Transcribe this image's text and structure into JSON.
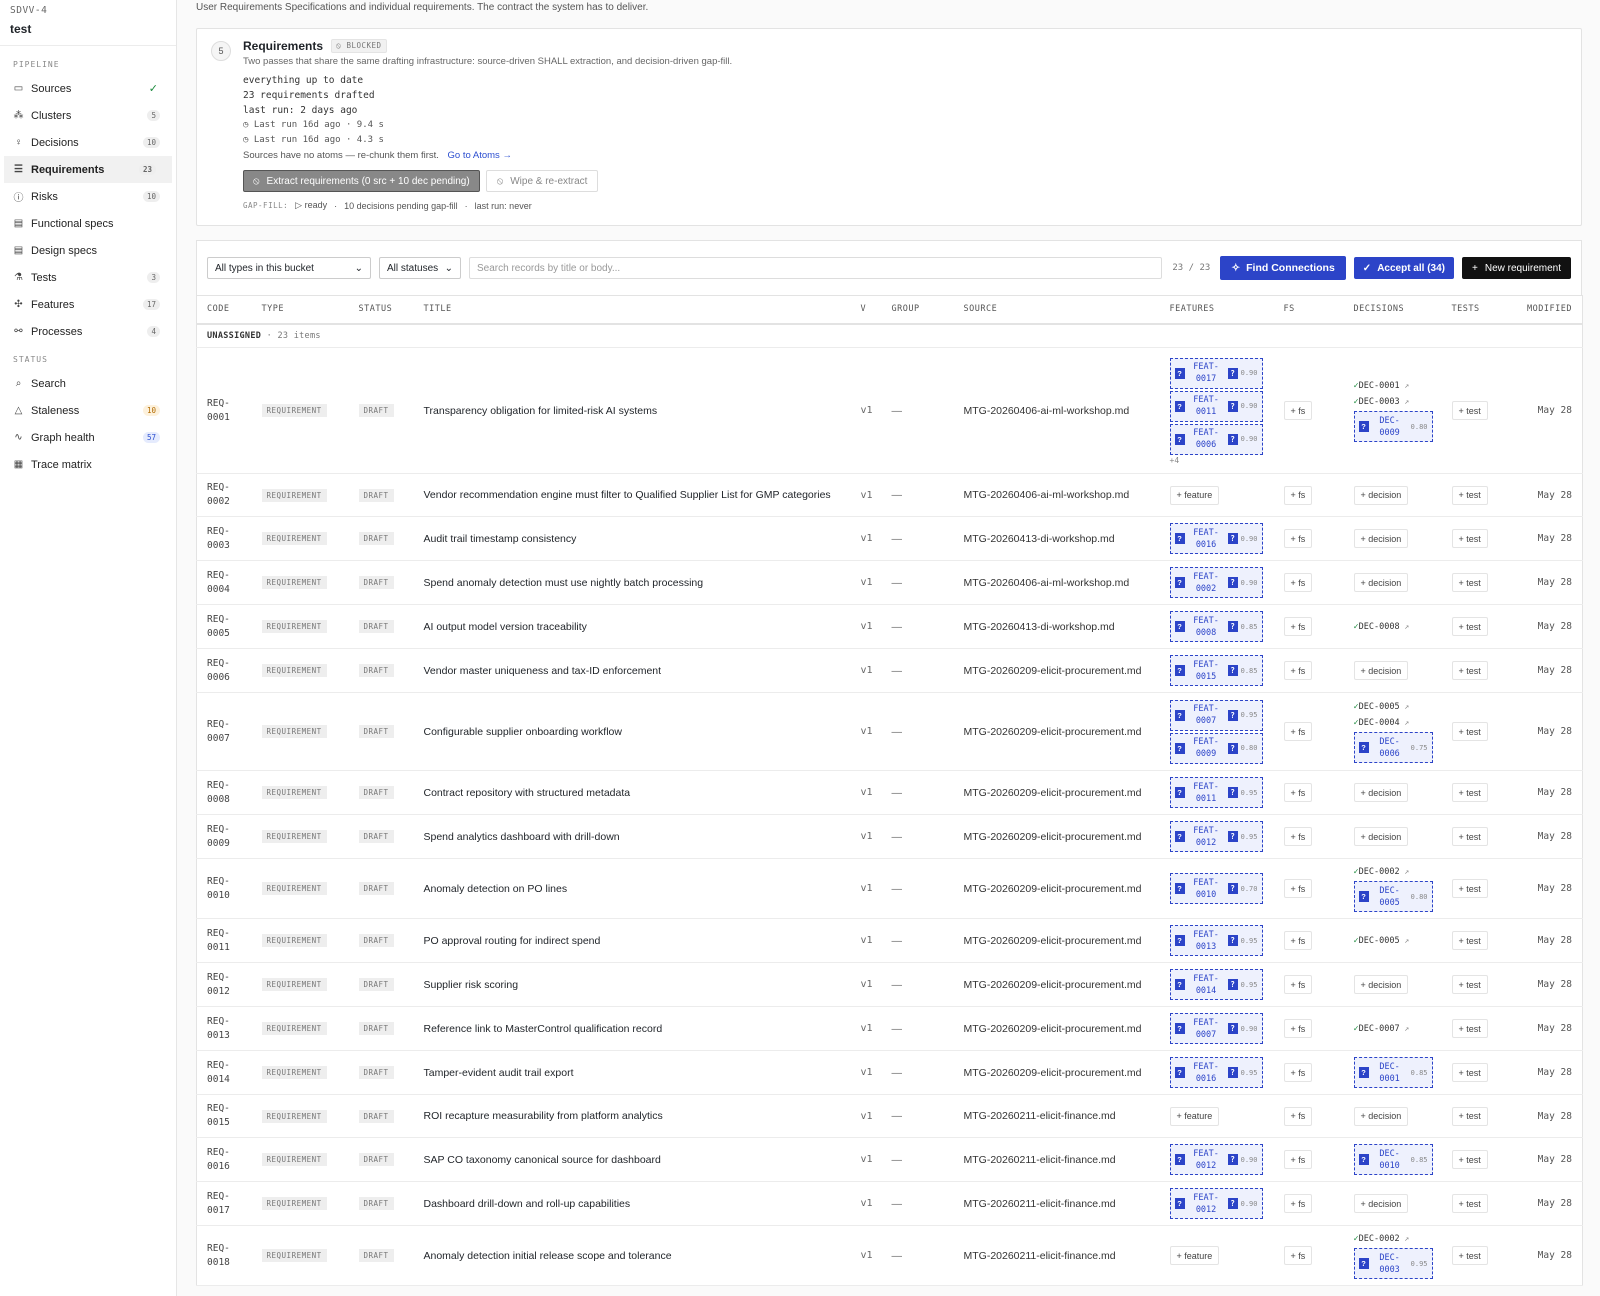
{
  "project": {
    "code": "SDVV-4",
    "name": "test"
  },
  "sidebar": {
    "pipeline_label": "PIPELINE",
    "status_label": "STATUS",
    "pipeline": [
      {
        "label": "Sources",
        "icon": "folder-icon",
        "badge": "",
        "check": "✓"
      },
      {
        "label": "Clusters",
        "icon": "cluster-icon",
        "badge": "5"
      },
      {
        "label": "Decisions",
        "icon": "bulb-icon",
        "badge": "10"
      },
      {
        "label": "Requirements",
        "icon": "list-icon",
        "badge": "23",
        "active": true
      },
      {
        "label": "Risks",
        "icon": "alert-circle-icon",
        "badge": "10"
      },
      {
        "label": "Functional specs",
        "icon": "doc-icon",
        "badge": ""
      },
      {
        "label": "Design specs",
        "icon": "doc-icon",
        "badge": ""
      },
      {
        "label": "Tests",
        "icon": "flask-icon",
        "badge": "3"
      },
      {
        "label": "Features",
        "icon": "sparkle-icon",
        "badge": "17"
      },
      {
        "label": "Processes",
        "icon": "process-icon",
        "badge": "4"
      }
    ],
    "status": [
      {
        "label": "Search",
        "icon": "search-icon",
        "badge": ""
      },
      {
        "label": "Staleness",
        "icon": "warning-icon",
        "badge": "10",
        "badge_color": "#b26b00"
      },
      {
        "label": "Graph health",
        "icon": "pulse-icon",
        "badge": "57",
        "badge_color": "#2c4fd0"
      },
      {
        "label": "Trace matrix",
        "icon": "grid-icon",
        "badge": ""
      }
    ]
  },
  "intro": "User Requirements Specifications and individual requirements. The contract the system has to deliver.",
  "step": {
    "number": "5",
    "title": "Requirements",
    "blocked": "BLOCKED",
    "subtitle": "Two passes that share the same drafting infrastructure: source-driven SHALL extraction, and decision-driven gap-fill.",
    "log1": "everything up to date",
    "log2": "23 requirements drafted",
    "log3": "last run: 2 days ago",
    "run1": "Last run 16d ago · 9.4 s",
    "run2": "Last run 16d ago · 4.3 s",
    "warning": "Sources have no atoms — re-chunk them first.",
    "warning_link": "Go to Atoms →",
    "extract_btn": "Extract requirements (0 src + 10 dec pending)",
    "wipe_btn": "Wipe & re-extract",
    "gap_label": "GAP-FILL:",
    "gap_ready": "ready",
    "gap_pending": "10 decisions pending gap-fill",
    "gap_last": "last run: never"
  },
  "toolbar": {
    "type_filter": "All types in this bucket",
    "status_filter": "All statuses",
    "search_placeholder": "Search records by title or body...",
    "count": "23 / 23",
    "find_btn": "Find Connections",
    "accept_btn": "Accept all (34)",
    "new_btn": "New requirement"
  },
  "table": {
    "columns": [
      "CODE",
      "TYPE",
      "STATUS",
      "TITLE",
      "V",
      "GROUP",
      "SOURCE",
      "FEATURES",
      "FS",
      "DECISIONS",
      "TESTS",
      "MODIFIED"
    ],
    "group_label": "UNASSIGNED",
    "group_count": "· 23 items",
    "rows": [
      {
        "code1": "REQ-",
        "code2": "0001",
        "type": "REQUIREMENT",
        "status": "DRAFT",
        "title": "Transparency obligation for limited-risk AI systems",
        "v": "v1",
        "group": "—",
        "source": "MTG-20260406-ai-ml-workshop.md",
        "features": [
          {
            "a": "FEAT-",
            "b": "0017",
            "s": "0.90"
          },
          {
            "a": "FEAT-",
            "b": "0011",
            "s": "0.90"
          },
          {
            "a": "FEAT-",
            "b": "0006",
            "s": "0.90"
          }
        ],
        "more": "+4",
        "decisions": [
          {
            "id": "DEC-0001"
          },
          {
            "id": "DEC-0003"
          }
        ],
        "dec_chips": [
          {
            "a": "DEC-",
            "b": "0009",
            "s": "0.80"
          }
        ],
        "modified": "May 28"
      },
      {
        "code1": "REQ-",
        "code2": "0002",
        "type": "REQUIREMENT",
        "status": "DRAFT",
        "title": "Vendor recommendation engine must filter to Qualified Supplier List for GMP categories",
        "v": "v1",
        "group": "—",
        "source": "MTG-20260406-ai-ml-workshop.md",
        "features": [],
        "decisions": [],
        "dec_chips": [],
        "modified": "May 28"
      },
      {
        "code1": "REQ-",
        "code2": "0003",
        "type": "REQUIREMENT",
        "status": "DRAFT",
        "title": "Audit trail timestamp consistency",
        "v": "v1",
        "group": "—",
        "source": "MTG-20260413-di-workshop.md",
        "features": [
          {
            "a": "FEAT-",
            "b": "0016",
            "s": "0.90"
          }
        ],
        "decisions": [],
        "dec_chips": [],
        "modified": "May 28"
      },
      {
        "code1": "REQ-",
        "code2": "0004",
        "type": "REQUIREMENT",
        "status": "DRAFT",
        "title": "Spend anomaly detection must use nightly batch processing",
        "v": "v1",
        "group": "—",
        "source": "MTG-20260406-ai-ml-workshop.md",
        "features": [
          {
            "a": "FEAT-",
            "b": "0002",
            "s": "0.90"
          }
        ],
        "decisions": [],
        "dec_chips": [],
        "modified": "May 28"
      },
      {
        "code1": "REQ-",
        "code2": "0005",
        "type": "REQUIREMENT",
        "status": "DRAFT",
        "title": "AI output model version traceability",
        "v": "v1",
        "group": "—",
        "source": "MTG-20260413-di-workshop.md",
        "features": [
          {
            "a": "FEAT-",
            "b": "0008",
            "s": "0.85"
          }
        ],
        "decisions": [
          {
            "id": "DEC-0008"
          }
        ],
        "dec_chips": [],
        "modified": "May 28"
      },
      {
        "code1": "REQ-",
        "code2": "0006",
        "type": "REQUIREMENT",
        "status": "DRAFT",
        "title": "Vendor master uniqueness and tax-ID enforcement",
        "v": "v1",
        "group": "—",
        "source": "MTG-20260209-elicit-procurement.md",
        "features": [
          {
            "a": "FEAT-",
            "b": "0015",
            "s": "0.85"
          }
        ],
        "decisions": [],
        "dec_chips": [],
        "modified": "May 28"
      },
      {
        "code1": "REQ-",
        "code2": "0007",
        "type": "REQUIREMENT",
        "status": "DRAFT",
        "title": "Configurable supplier onboarding workflow",
        "v": "v1",
        "group": "—",
        "source": "MTG-20260209-elicit-procurement.md",
        "features": [
          {
            "a": "FEAT-",
            "b": "0007",
            "s": "0.95"
          },
          {
            "a": "FEAT-",
            "b": "0009",
            "s": "0.80"
          }
        ],
        "decisions": [
          {
            "id": "DEC-0005"
          },
          {
            "id": "DEC-0004"
          }
        ],
        "dec_chips": [
          {
            "a": "DEC-",
            "b": "0006",
            "s": "0.75"
          }
        ],
        "modified": "May 28"
      },
      {
        "code1": "REQ-",
        "code2": "0008",
        "type": "REQUIREMENT",
        "status": "DRAFT",
        "title": "Contract repository with structured metadata",
        "v": "v1",
        "group": "—",
        "source": "MTG-20260209-elicit-procurement.md",
        "features": [
          {
            "a": "FEAT-",
            "b": "0011",
            "s": "0.95"
          }
        ],
        "decisions": [],
        "dec_chips": [],
        "modified": "May 28"
      },
      {
        "code1": "REQ-",
        "code2": "0009",
        "type": "REQUIREMENT",
        "status": "DRAFT",
        "title": "Spend analytics dashboard with drill-down",
        "v": "v1",
        "group": "—",
        "source": "MTG-20260209-elicit-procurement.md",
        "features": [
          {
            "a": "FEAT-",
            "b": "0012",
            "s": "0.95"
          }
        ],
        "decisions": [],
        "dec_chips": [],
        "modified": "May 28"
      },
      {
        "code1": "REQ-",
        "code2": "0010",
        "type": "REQUIREMENT",
        "status": "DRAFT",
        "title": "Anomaly detection on PO lines",
        "v": "v1",
        "group": "—",
        "source": "MTG-20260209-elicit-procurement.md",
        "features": [
          {
            "a": "FEAT-",
            "b": "0010",
            "s": "0.70"
          }
        ],
        "decisions": [
          {
            "id": "DEC-0002"
          }
        ],
        "dec_chips": [
          {
            "a": "DEC-",
            "b": "0005",
            "s": "0.80"
          }
        ],
        "modified": "May 28"
      },
      {
        "code1": "REQ-",
        "code2": "0011",
        "type": "REQUIREMENT",
        "status": "DRAFT",
        "title": "PO approval routing for indirect spend",
        "v": "v1",
        "group": "—",
        "source": "MTG-20260209-elicit-procurement.md",
        "features": [
          {
            "a": "FEAT-",
            "b": "0013",
            "s": "0.95"
          }
        ],
        "decisions": [
          {
            "id": "DEC-0005"
          }
        ],
        "dec_chips": [],
        "modified": "May 28"
      },
      {
        "code1": "REQ-",
        "code2": "0012",
        "type": "REQUIREMENT",
        "status": "DRAFT",
        "title": "Supplier risk scoring",
        "v": "v1",
        "group": "—",
        "source": "MTG-20260209-elicit-procurement.md",
        "features": [
          {
            "a": "FEAT-",
            "b": "0014",
            "s": "0.95"
          }
        ],
        "decisions": [],
        "dec_chips": [],
        "modified": "May 28"
      },
      {
        "code1": "REQ-",
        "code2": "0013",
        "type": "REQUIREMENT",
        "status": "DRAFT",
        "title": "Reference link to MasterControl qualification record",
        "v": "v1",
        "group": "—",
        "source": "MTG-20260209-elicit-procurement.md",
        "features": [
          {
            "a": "FEAT-",
            "b": "0007",
            "s": "0.90"
          }
        ],
        "decisions": [
          {
            "id": "DEC-0007"
          }
        ],
        "dec_chips": [],
        "modified": "May 28"
      },
      {
        "code1": "REQ-",
        "code2": "0014",
        "type": "REQUIREMENT",
        "status": "DRAFT",
        "title": "Tamper-evident audit trail export",
        "v": "v1",
        "group": "—",
        "source": "MTG-20260209-elicit-procurement.md",
        "features": [
          {
            "a": "FEAT-",
            "b": "0016",
            "s": "0.95"
          }
        ],
        "decisions": [],
        "dec_chips": [
          {
            "a": "DEC-",
            "b": "0001",
            "s": "0.85"
          }
        ],
        "modified": "May 28"
      },
      {
        "code1": "REQ-",
        "code2": "0015",
        "type": "REQUIREMENT",
        "status": "DRAFT",
        "title": "ROI recapture measurability from platform analytics",
        "v": "v1",
        "group": "—",
        "source": "MTG-20260211-elicit-finance.md",
        "features": [],
        "decisions": [],
        "dec_chips": [],
        "modified": "May 28"
      },
      {
        "code1": "REQ-",
        "code2": "0016",
        "type": "REQUIREMENT",
        "status": "DRAFT",
        "title": "SAP CO taxonomy canonical source for dashboard",
        "v": "v1",
        "group": "—",
        "source": "MTG-20260211-elicit-finance.md",
        "features": [
          {
            "a": "FEAT-",
            "b": "0012",
            "s": "0.90"
          }
        ],
        "decisions": [],
        "dec_chips": [
          {
            "a": "DEC-",
            "b": "0010",
            "s": "0.85"
          }
        ],
        "modified": "May 28"
      },
      {
        "code1": "REQ-",
        "code2": "0017",
        "type": "REQUIREMENT",
        "status": "DRAFT",
        "title": "Dashboard drill-down and roll-up capabilities",
        "v": "v1",
        "group": "—",
        "source": "MTG-20260211-elicit-finance.md",
        "features": [
          {
            "a": "FEAT-",
            "b": "0012",
            "s": "0.90"
          }
        ],
        "decisions": [],
        "dec_chips": [],
        "modified": "May 28"
      },
      {
        "code1": "REQ-",
        "code2": "0018",
        "type": "REQUIREMENT",
        "status": "DRAFT",
        "title": "Anomaly detection initial release scope and tolerance",
        "v": "v1",
        "group": "—",
        "source": "MTG-20260211-elicit-finance.md",
        "features": [],
        "decisions": [
          {
            "id": "DEC-0002"
          }
        ],
        "dec_chips": [
          {
            "a": "DEC-",
            "b": "0003",
            "s": "0.95"
          }
        ],
        "modified": "May 28"
      }
    ],
    "labels": {
      "feature": "+ feature",
      "fs": "+ fs",
      "decision": "+ decision",
      "test": "+ test",
      "q": "?"
    }
  },
  "colors": {
    "accent": "#2c44c8",
    "ok": "#1a8a3c",
    "warn": "#b26b00"
  }
}
